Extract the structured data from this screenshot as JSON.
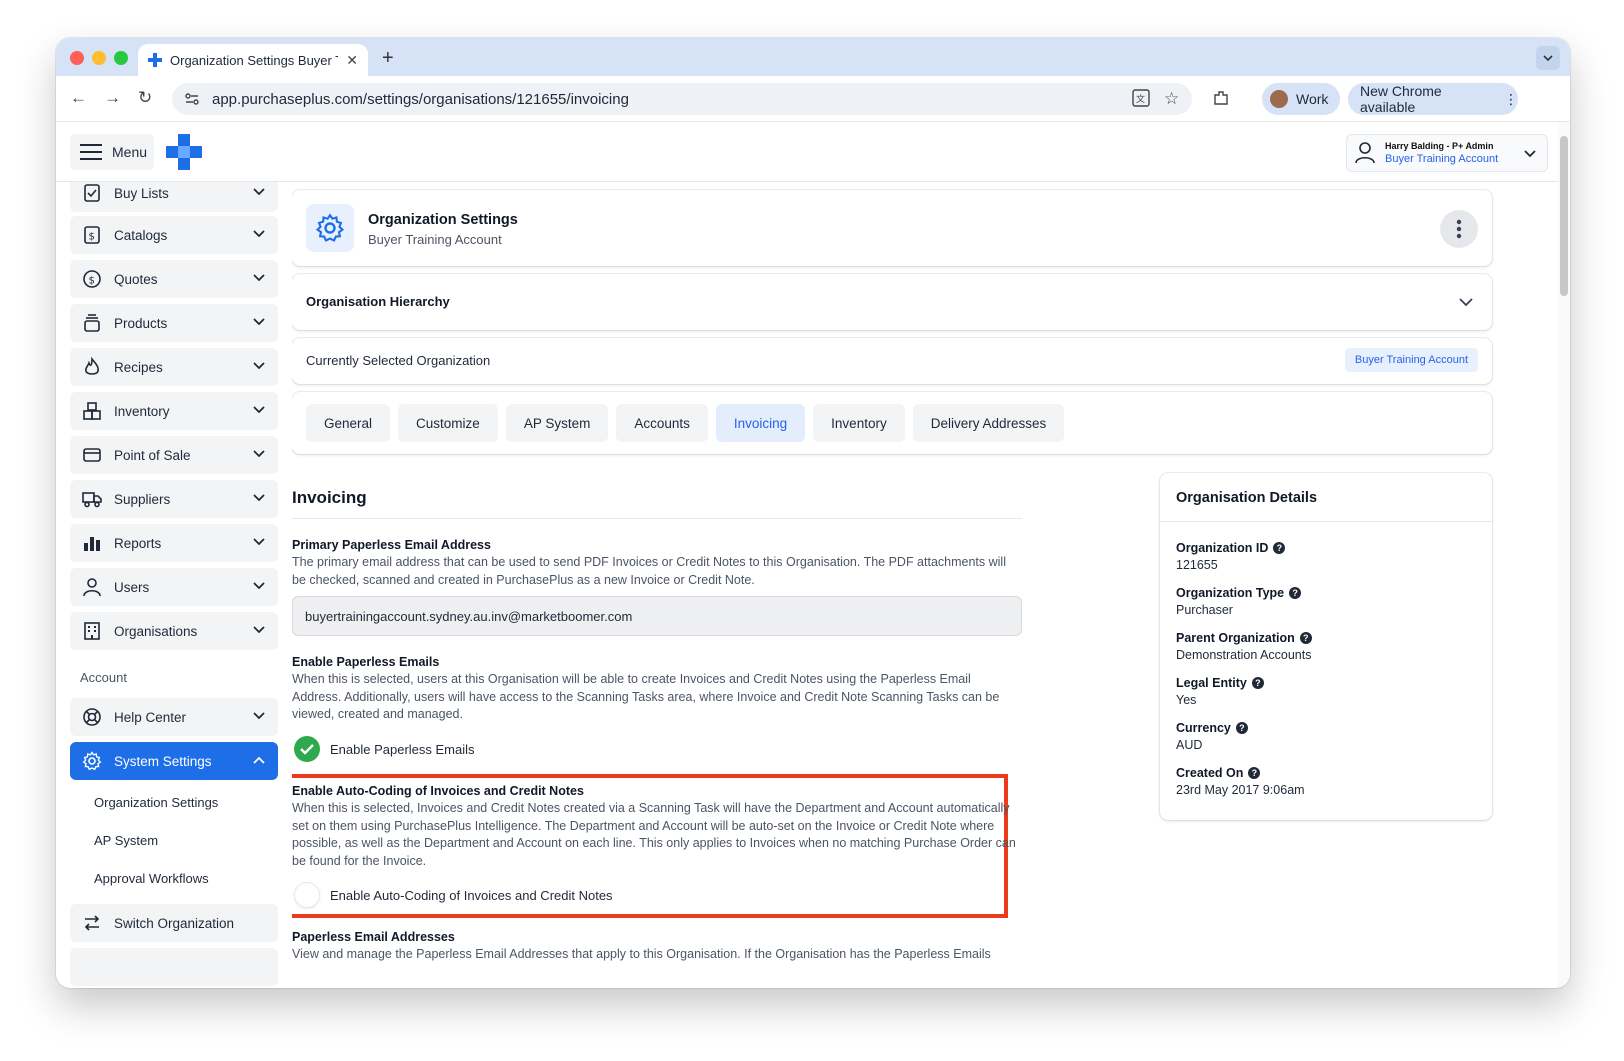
{
  "browser": {
    "tab_title": "Organization Settings Buyer T",
    "url": "app.purchaseplus.com/settings/organisations/121655/invoicing",
    "profile_label": "Work",
    "update_label": "New Chrome available"
  },
  "header": {
    "menu_label": "Menu",
    "user_name": "Harry Balding - P+ Admin",
    "user_account": "Buyer Training Account"
  },
  "sidebar": {
    "items": [
      {
        "label": "Buy Lists",
        "icon": "checklist-icon"
      },
      {
        "label": "Catalogs",
        "icon": "dollar-doc-icon"
      },
      {
        "label": "Quotes",
        "icon": "dollar-circle-icon"
      },
      {
        "label": "Products",
        "icon": "stack-icon"
      },
      {
        "label": "Recipes",
        "icon": "flame-icon"
      },
      {
        "label": "Inventory",
        "icon": "boxes-icon"
      },
      {
        "label": "Point of Sale",
        "icon": "card-icon"
      },
      {
        "label": "Suppliers",
        "icon": "truck-icon"
      },
      {
        "label": "Reports",
        "icon": "bar-chart-icon"
      },
      {
        "label": "Users",
        "icon": "user-icon"
      },
      {
        "label": "Organisations",
        "icon": "building-icon"
      }
    ],
    "account_heading": "Account",
    "help_center": "Help Center",
    "system_settings": "System Settings",
    "sub_items": [
      "Organization Settings",
      "AP System",
      "Approval Workflows"
    ],
    "switch_org": "Switch Organization"
  },
  "org_header": {
    "title": "Organization Settings",
    "subtitle": "Buyer Training Account"
  },
  "hierarchy": {
    "title": "Organisation Hierarchy"
  },
  "selected": {
    "label": "Currently Selected Organization",
    "badge": "Buyer Training Account"
  },
  "tabs": [
    {
      "label": "General",
      "active": false
    },
    {
      "label": "Customize",
      "active": false
    },
    {
      "label": "AP System",
      "active": false
    },
    {
      "label": "Accounts",
      "active": false
    },
    {
      "label": "Invoicing",
      "active": true
    },
    {
      "label": "Inventory",
      "active": false
    },
    {
      "label": "Delivery Addresses",
      "active": false
    }
  ],
  "invoicing": {
    "title": "Invoicing",
    "primary_label": "Primary Paperless Email Address",
    "primary_desc": "The primary email address that can be used to send PDF Invoices or Credit Notes to this Organisation. The PDF attachments will be checked, scanned and created in PurchasePlus as a new Invoice or Credit Note.",
    "primary_value": "buyertrainingaccount.sydney.au.inv@marketboomer.com",
    "paperless_label": "Enable Paperless Emails",
    "paperless_desc": "When this is selected, users at this Organisation will be able to create Invoices and Credit Notes using the Paperless Email Address. Additionally, users will have access to the Scanning Tasks area, where Invoice and Credit Note Scanning Tasks can be viewed, created and managed.",
    "paperless_check": "Enable Paperless Emails",
    "paperless_enabled": true,
    "autocoding_label": "Enable Auto-Coding of Invoices and Credit Notes",
    "autocoding_desc": "When this is selected, Invoices and Credit Notes created via a Scanning Task will have the Department and Account automatically set on them using PurchasePlus Intelligence. The Department and Account will be auto-set on the Invoice or Credit Note where possible, as well as the Department and Account on each line. This only applies to Invoices when no matching Purchase Order can be found for the Invoice.",
    "autocoding_check": "Enable Auto-Coding of Invoices and Credit Notes",
    "autocoding_enabled": false,
    "addresses_label": "Paperless Email Addresses",
    "addresses_desc": "View and manage the Paperless Email Addresses that apply to this Organisation. If the Organisation has the Paperless Emails"
  },
  "details": {
    "title": "Organisation Details",
    "rows": [
      {
        "label": "Organization ID",
        "value": "121655"
      },
      {
        "label": "Organization Type",
        "value": "Purchaser"
      },
      {
        "label": "Parent Organization",
        "value": "Demonstration Accounts"
      },
      {
        "label": "Legal Entity",
        "value": "Yes"
      },
      {
        "label": "Currency",
        "value": "AUD"
      },
      {
        "label": "Created On",
        "value": "23rd May 2017 9:06am"
      }
    ]
  },
  "colors": {
    "accent": "#1e6ee8",
    "highlight": "#ec3b1c",
    "success": "#2fa94e"
  }
}
